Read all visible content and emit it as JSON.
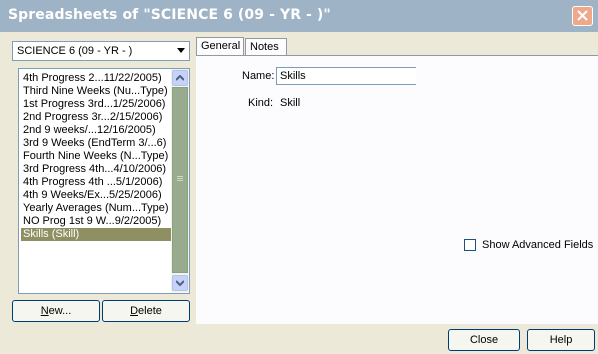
{
  "window": {
    "title": "Spreadsheets of \"SCIENCE 6 (09 - YR - )\""
  },
  "class_selector": {
    "value": "SCIENCE 6 (09 - YR - )"
  },
  "spreadsheets": {
    "items": [
      "4th Progress 2...11/22/2005)",
      "Third Nine Weeks (Nu...Type)",
      "1st Progress 3rd...1/25/2006)",
      "2nd Progress 3r...2/15/2006)",
      "2nd 9 weeks/...12/16/2005)",
      "3rd 9 Weeks (EndTerm 3/...6)",
      "Fourth Nine Weeks (N...Type)",
      "3rd Progress 4th...4/10/2006)",
      "4th Progress 4th ...5/1/2006)",
      "4th 9 Weeks/Ex...5/25/2006)",
      "Yearly Averages (Num...Type)",
      "NO Prog 1st 9 W...9/2/2005)",
      "Skills (Skill)"
    ],
    "selected_index": 12
  },
  "buttons": {
    "new_label": "New...",
    "delete_label": "Delete",
    "close_label": "Close",
    "help_label": "Help"
  },
  "tabs": [
    "General",
    "Notes"
  ],
  "general": {
    "name_label": "Name:",
    "name_value": "Skills",
    "kind_label": "Kind:",
    "kind_value": "Skill",
    "advanced_label": "Show Advanced Fields",
    "advanced_checked": false
  },
  "colors": {
    "titlebar": "#9fb3c6",
    "selection": "#8f8f64",
    "scroll_thumb": "#98ab8c",
    "close_button": "#f0a88a"
  },
  "icons": {
    "window_close": "close-icon",
    "combo_arrow": "chevron-down-icon",
    "scroll_up": "chevron-up-icon",
    "scroll_down": "chevron-down-icon"
  }
}
